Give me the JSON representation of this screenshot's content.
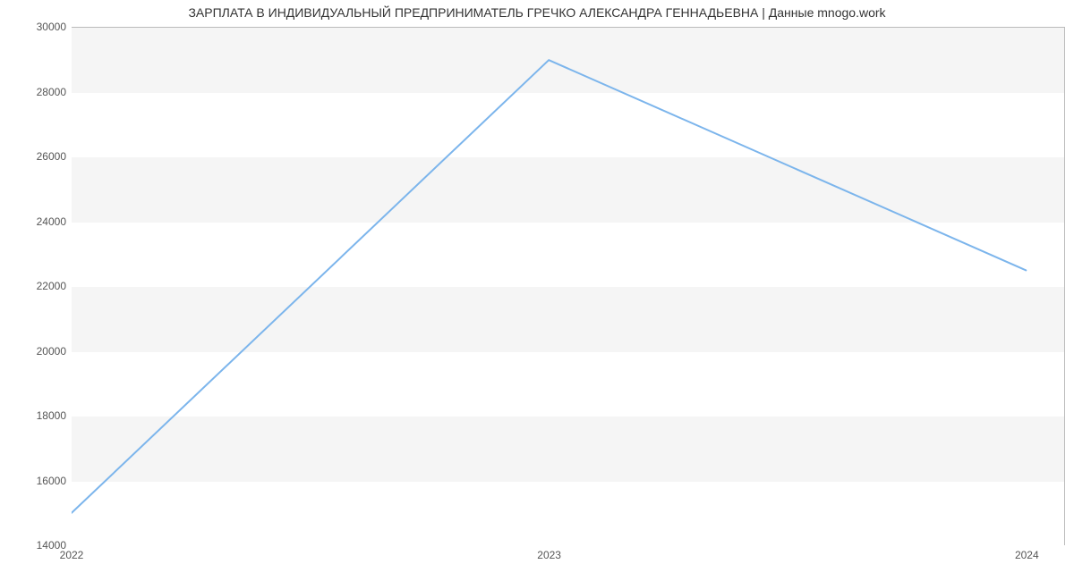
{
  "chart_data": {
    "type": "line",
    "title": "ЗАРПЛАТА В ИНДИВИДУАЛЬНЫЙ ПРЕДПРИНИМАТЕЛЬ ГРЕЧКО АЛЕКСАНДРА ГЕННАДЬЕВНА | Данные mnogo.work",
    "x": [
      2022,
      2023,
      2024
    ],
    "values": [
      15000,
      29000,
      22500
    ],
    "xlabel": "",
    "ylabel": "",
    "xlim": [
      2022,
      2024.08
    ],
    "ylim": [
      14000,
      30000
    ],
    "y_ticks": [
      14000,
      16000,
      18000,
      20000,
      22000,
      24000,
      26000,
      28000,
      30000
    ],
    "x_ticks": [
      2022,
      2023,
      2024
    ],
    "line_color": "#7cb5ec"
  }
}
